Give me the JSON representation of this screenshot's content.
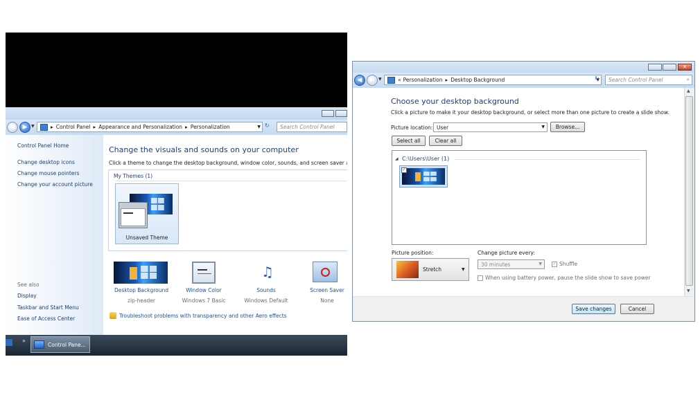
{
  "left_window": {
    "address": {
      "segments": [
        "Control Panel",
        "Appearance and Personalization",
        "Personalization"
      ],
      "search_placeholder": "Search Control Panel"
    },
    "sidebar": {
      "home": "Control Panel Home",
      "links": [
        "Change desktop icons",
        "Change mouse pointers",
        "Change your account picture"
      ],
      "see_also_heading": "See also",
      "see_also": [
        "Display",
        "Taskbar and Start Menu",
        "Ease of Access Center"
      ]
    },
    "main": {
      "heading": "Change the visuals and sounds on your computer",
      "description": "Click a theme to change the desktop background, window color, sounds, and screen saver all at o",
      "my_themes_label": "My Themes (1)",
      "theme_name": "Unsaved Theme"
    },
    "bottom_items": [
      {
        "label": "Desktop Background",
        "sub": "zip-header",
        "icon": "desktop-background-icon"
      },
      {
        "label": "Window Color",
        "sub": "Windows 7 Basic",
        "icon": "window-color-icon"
      },
      {
        "label": "Sounds",
        "sub": "Windows Default",
        "icon": "sounds-icon"
      },
      {
        "label": "Screen Saver",
        "sub": "None",
        "icon": "screen-saver-icon"
      }
    ],
    "troubleshoot_link": "Troubleshoot problems with transparency and other Aero effects",
    "taskbar": {
      "chevron": "»",
      "item_label": "Control Pane..."
    }
  },
  "right_window": {
    "address": {
      "chevrons": "«",
      "segments": [
        "Personalization",
        "Desktop Background"
      ],
      "search_placeholder": "Search Control Panel"
    },
    "heading": "Choose your desktop background",
    "description": "Click a picture to make it your desktop background, or select more than one picture to create a slide show.",
    "picture_location_label": "Picture location:",
    "picture_location_value": "User",
    "browse_button": "Browse...",
    "select_all_button": "Select all",
    "clear_all_button": "Clear all",
    "group_label": "C:\\Users\\User (1)",
    "picture_position_label": "Picture position:",
    "picture_position_value": "Stretch",
    "change_every_label": "Change picture every:",
    "change_every_value": "30 minutes",
    "shuffle_label": "Shuffle",
    "battery_label": "When using battery power, pause the slide show to save power",
    "save_button": "Save changes",
    "cancel_button": "Cancel"
  }
}
